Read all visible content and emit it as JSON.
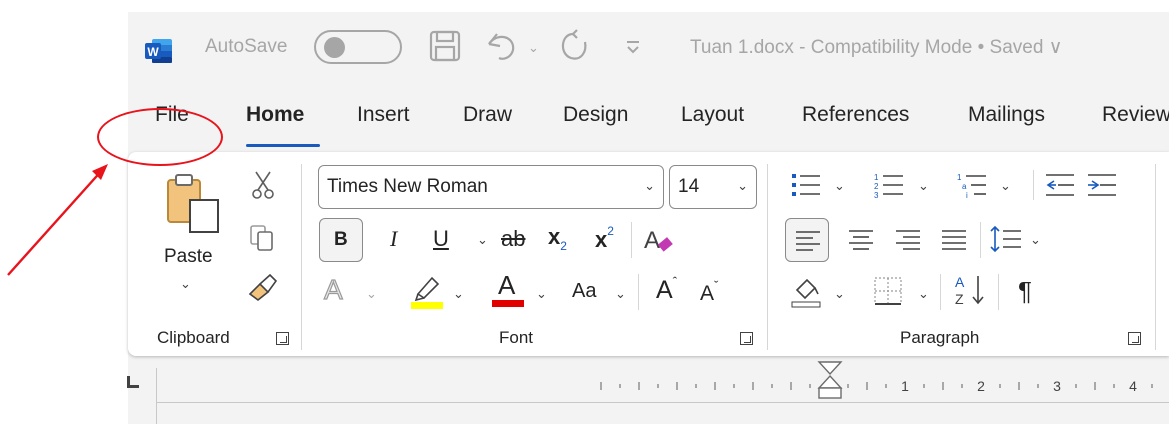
{
  "titlebar": {
    "autosave_label": "AutoSave",
    "doc_title": "Tuan 1.docx  -  Compatibility Mode • Saved ∨",
    "word_icon_letter": "W"
  },
  "tabs": [
    {
      "label": "File"
    },
    {
      "label": "Home"
    },
    {
      "label": "Insert"
    },
    {
      "label": "Draw"
    },
    {
      "label": "Design"
    },
    {
      "label": "Layout"
    },
    {
      "label": "References"
    },
    {
      "label": "Mailings"
    },
    {
      "label": "Review"
    }
  ],
  "clipboard": {
    "paste_label": "Paste",
    "group_label": "Clipboard"
  },
  "font": {
    "font_name": "Times New Roman",
    "font_size": "14",
    "bold": "B",
    "italic": "I",
    "underline": "U",
    "strike": "ab",
    "subscript_base": "x",
    "subscript_mark": "2",
    "superscript_base": "x",
    "superscript_mark": "2",
    "change_case": "Aa",
    "grow": "A",
    "shrink": "A",
    "font_color_letter": "A",
    "text_effects_letter": "A",
    "group_label": "Font"
  },
  "paragraph": {
    "group_label": "Paragraph",
    "pilcrow": "¶"
  },
  "ruler": {
    "numbers": [
      "1",
      "2",
      "3",
      "4"
    ]
  },
  "colors": {
    "accent_blue": "#185abd",
    "highlight_yellow": "#ffff00",
    "font_color_red": "#e00000",
    "annotation_red": "#e8131b"
  }
}
